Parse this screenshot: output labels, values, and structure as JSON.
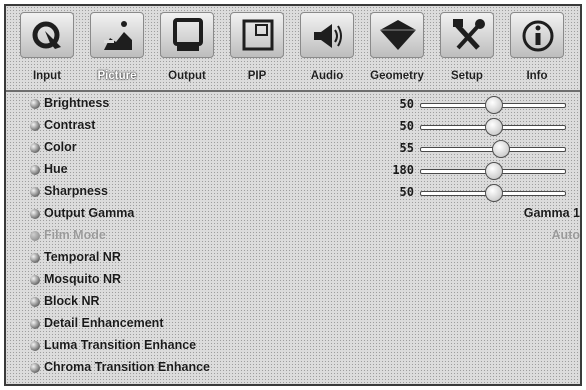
{
  "tabs": [
    {
      "label": "Input",
      "icon": "input-icon"
    },
    {
      "label": "Picture",
      "icon": "picture-icon",
      "active": true
    },
    {
      "label": "Output",
      "icon": "output-icon"
    },
    {
      "label": "PIP",
      "icon": "pip-icon"
    },
    {
      "label": "Audio",
      "icon": "audio-icon"
    },
    {
      "label": "Geometry",
      "icon": "geometry-icon"
    },
    {
      "label": "Setup",
      "icon": "setup-icon"
    },
    {
      "label": "Info",
      "icon": "info-icon"
    }
  ],
  "menu": [
    {
      "label": "Brightness",
      "value": "50",
      "level": 0.5
    },
    {
      "label": "Contrast",
      "value": "50",
      "level": 0.5
    },
    {
      "label": "Color",
      "value": "55",
      "level": 0.55
    },
    {
      "label": "Hue",
      "value": "180",
      "level": 0.5
    },
    {
      "label": "Sharpness",
      "value": "50",
      "level": 0.5
    },
    {
      "label": "Output Gamma",
      "text": "Gamma 1"
    },
    {
      "label": "Film Mode",
      "text": "Auto",
      "disabled": true
    },
    {
      "label": "Temporal NR"
    },
    {
      "label": "Mosquito NR"
    },
    {
      "label": "Block NR"
    },
    {
      "label": "Detail Enhancement"
    },
    {
      "label": "Luma Transition Enhance"
    },
    {
      "label": "Chroma Transition Enhance"
    }
  ]
}
